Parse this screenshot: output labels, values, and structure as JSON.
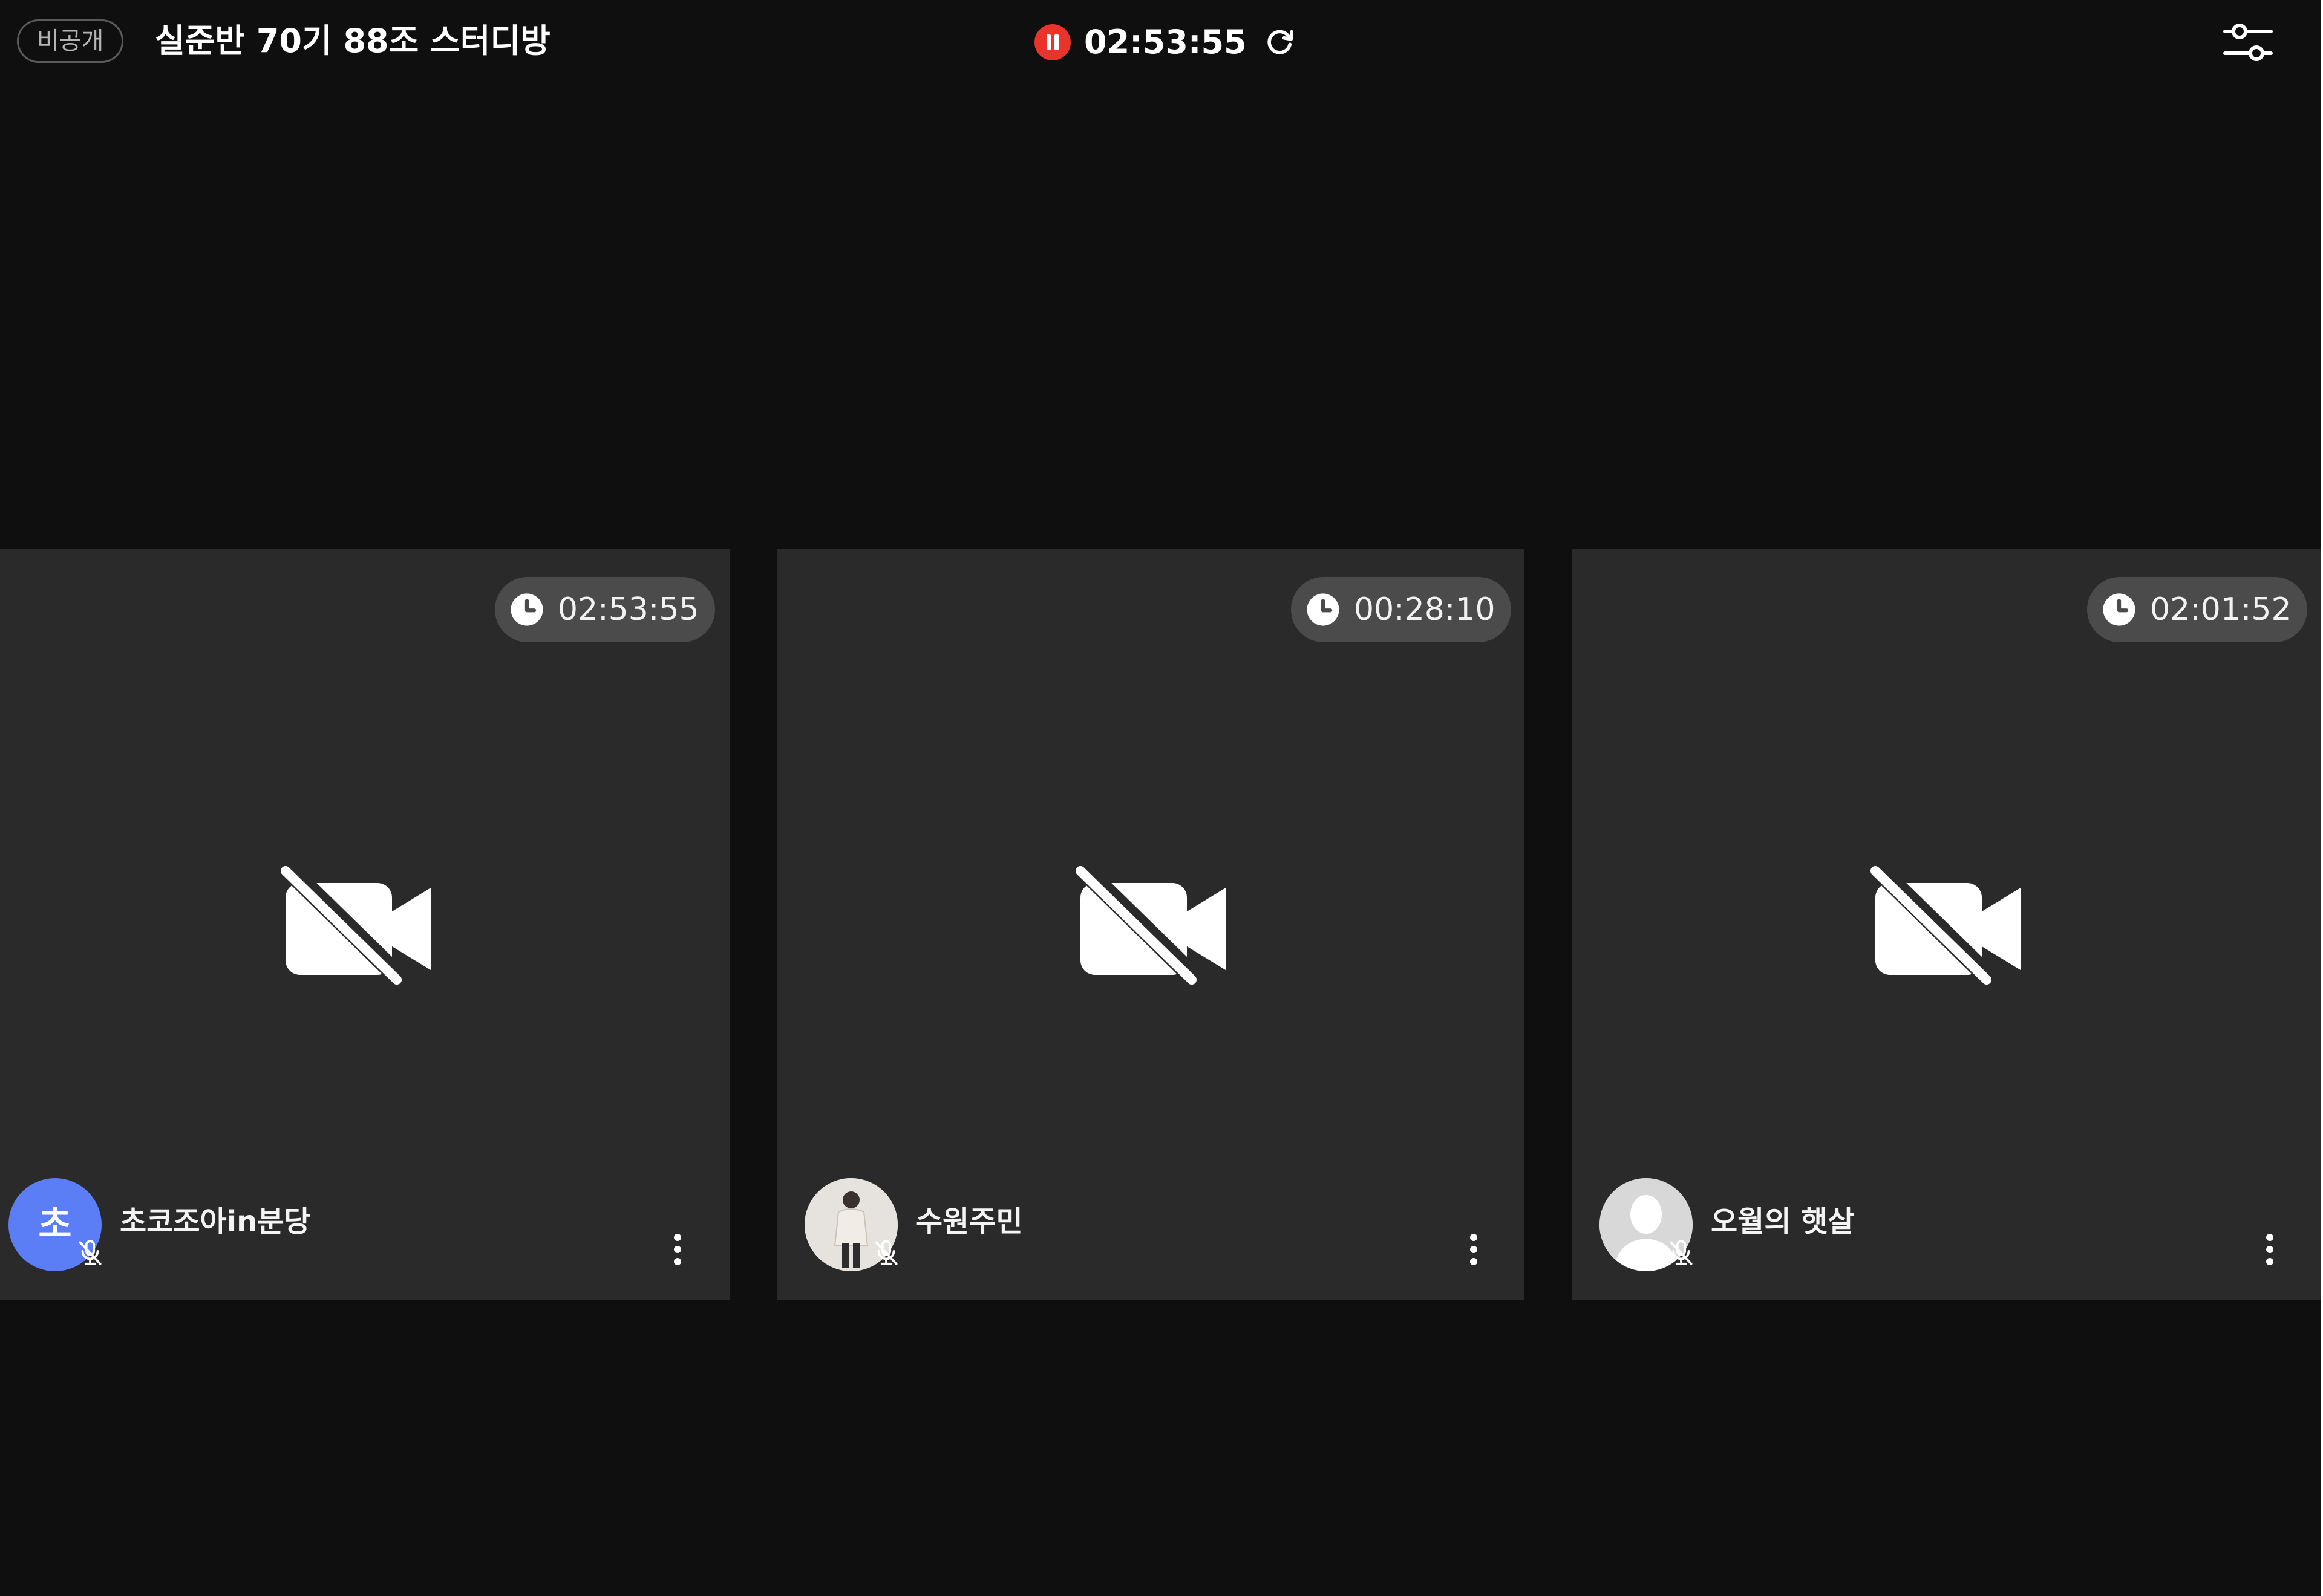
{
  "header": {
    "privacy_label": "비공개",
    "room_title": "실준반 70기 88조 스터디방",
    "session_time": "02:53:55",
    "pause_icon": "pause-icon",
    "refresh_icon": "refresh-icon",
    "settings_icon": "sliders-icon",
    "pause_color": "#e8342b"
  },
  "participants": [
    {
      "name": "초코조아in분당",
      "time": "02:53:55",
      "avatar_initial": "초",
      "avatar_type": "initial",
      "avatar_color": "#5b7ef7",
      "camera": "off",
      "mic": "off"
    },
    {
      "name": "수원주민",
      "time": "00:28:10",
      "avatar_type": "photo",
      "camera": "off",
      "mic": "off"
    },
    {
      "name": "오월의 햇살",
      "time": "02:01:52",
      "avatar_type": "default-silhouette",
      "camera": "off",
      "mic": "off"
    }
  ],
  "icons": {
    "timer": "clock-icon",
    "camera_off": "camera-off-icon",
    "mic_off": "mic-off-icon",
    "more": "more-vertical-icon"
  },
  "colors": {
    "background": "#0f0f0f",
    "tile": "#2a2a2a",
    "timer_pill": "#4b4b4b"
  }
}
